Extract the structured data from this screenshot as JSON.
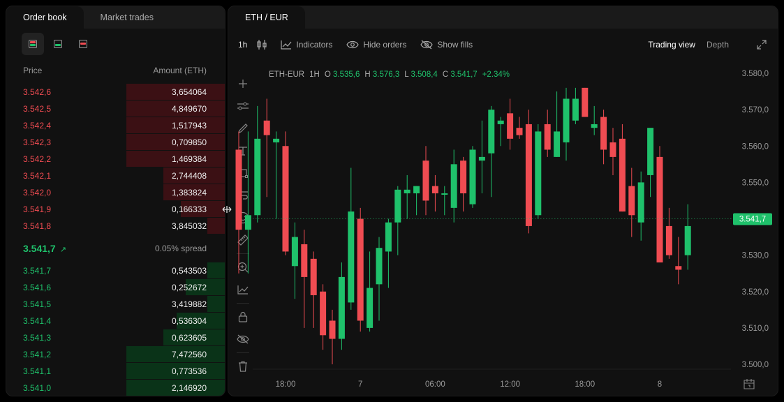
{
  "orderbook": {
    "tabs": [
      {
        "label": "Order book",
        "active": true
      },
      {
        "label": "Market trades",
        "active": false
      }
    ],
    "header": {
      "price": "Price",
      "amount": "Amount (ETH)"
    },
    "asks": [
      {
        "price": "3.542,6",
        "amount": "3,654064",
        "depth": 0.45
      },
      {
        "price": "3.542,5",
        "amount": "4,849670",
        "depth": 0.45
      },
      {
        "price": "3.542,4",
        "amount": "1,517943",
        "depth": 0.45
      },
      {
        "price": "3.542,3",
        "amount": "0,709850",
        "depth": 0.45
      },
      {
        "price": "3.542,2",
        "amount": "1,469384",
        "depth": 0.45
      },
      {
        "price": "3.542,1",
        "amount": "2,744408",
        "depth": 0.28
      },
      {
        "price": "3.542,0",
        "amount": "1,383824",
        "depth": 0.28
      },
      {
        "price": "3.541,9",
        "amount": "0,166333",
        "depth": 0.2
      },
      {
        "price": "3.541,8",
        "amount": "3,845032",
        "depth": 0.08
      }
    ],
    "spread": {
      "price": "3.541,7",
      "arrow": "↗",
      "text": "0.05% spread"
    },
    "bids": [
      {
        "price": "3.541,7",
        "amount": "0,543503",
        "depth": 0.08
      },
      {
        "price": "3.541,6",
        "amount": "0,252672",
        "depth": 0.18
      },
      {
        "price": "3.541,5",
        "amount": "3,419882",
        "depth": 0.08
      },
      {
        "price": "3.541,4",
        "amount": "0,536304",
        "depth": 0.22
      },
      {
        "price": "3.541,3",
        "amount": "0,623605",
        "depth": 0.28
      },
      {
        "price": "3.541,2",
        "amount": "7,472560",
        "depth": 0.45
      },
      {
        "price": "3.541,1",
        "amount": "0,773536",
        "depth": 0.45
      },
      {
        "price": "3.541,0",
        "amount": "2,146920",
        "depth": 0.45
      }
    ]
  },
  "chart_panel": {
    "tab": "ETH / EUR",
    "toolbar": {
      "timeframe": "1h",
      "indicators": "Indicators",
      "hide_orders": "Hide orders",
      "show_fills": "Show fills",
      "trading_view": "Trading view",
      "depth": "Depth"
    },
    "ohlc": {
      "symbol": "ETH-EUR",
      "interval": "1H",
      "o_label": "O",
      "o": "3.535,6",
      "h_label": "H",
      "h": "3.576,3",
      "l_label": "L",
      "l": "3.508,4",
      "c_label": "C",
      "c": "3.541,7",
      "change": "+2.34%"
    },
    "colors": {
      "up": "#1fc16b",
      "down": "#f04c52"
    }
  },
  "chart_data": {
    "type": "candlestick",
    "y_ticks": [
      "3.580,0",
      "3.570,0",
      "3.560,0",
      "3.550,0",
      "3.540,0",
      "3.530,0",
      "3.520,0",
      "3.510,0",
      "3.500,0"
    ],
    "y_tick_values": [
      3580,
      3570,
      3560,
      3550,
      3540,
      3530,
      3520,
      3510,
      3500
    ],
    "x_ticks": [
      {
        "label": "18:00",
        "index": 5
      },
      {
        "label": "7",
        "index": 13
      },
      {
        "label": "06:00",
        "index": 21
      },
      {
        "label": "12:00",
        "index": 29
      },
      {
        "label": "18:00",
        "index": 37
      },
      {
        "label": "8",
        "index": 45
      }
    ],
    "ylim": [
      3500,
      3580
    ],
    "current_price": {
      "label": "3.541,7",
      "value": 3540
    },
    "candles": [
      {
        "o": 3559,
        "h": 3564,
        "l": 3525,
        "c": 3537
      },
      {
        "o": 3537,
        "h": 3564,
        "l": 3525,
        "c": 3541
      },
      {
        "o": 3541,
        "h": 3571,
        "l": 3539,
        "c": 3562
      },
      {
        "o": 3567,
        "h": 3573,
        "l": 3546,
        "c": 3563
      },
      {
        "o": 3561,
        "h": 3564,
        "l": 3540,
        "c": 3562
      },
      {
        "o": 3560,
        "h": 3564,
        "l": 3530,
        "c": 3531
      },
      {
        "o": 3527,
        "h": 3539,
        "l": 3518,
        "c": 3535
      },
      {
        "o": 3533,
        "h": 3537,
        "l": 3510,
        "c": 3524
      },
      {
        "o": 3529,
        "h": 3531,
        "l": 3510,
        "c": 3519
      },
      {
        "o": 3520,
        "h": 3522,
        "l": 3504,
        "c": 3508
      },
      {
        "o": 3512,
        "h": 3515,
        "l": 3500,
        "c": 3507
      },
      {
        "o": 3507,
        "h": 3528,
        "l": 3504,
        "c": 3524
      },
      {
        "o": 3517,
        "h": 3554,
        "l": 3515,
        "c": 3542
      },
      {
        "o": 3540,
        "h": 3543,
        "l": 3509,
        "c": 3512
      },
      {
        "o": 3510,
        "h": 3531,
        "l": 3509,
        "c": 3521
      },
      {
        "o": 3522,
        "h": 3535,
        "l": 3512,
        "c": 3532
      },
      {
        "o": 3531,
        "h": 3540,
        "l": 3521,
        "c": 3539
      },
      {
        "o": 3539,
        "h": 3549,
        "l": 3530,
        "c": 3548
      },
      {
        "o": 3547,
        "h": 3552,
        "l": 3540,
        "c": 3548
      },
      {
        "o": 3547,
        "h": 3549,
        "l": 3541,
        "c": 3549
      },
      {
        "o": 3556,
        "h": 3560,
        "l": 3541,
        "c": 3545
      },
      {
        "o": 3549,
        "h": 3552,
        "l": 3542,
        "c": 3547
      },
      {
        "o": 3547,
        "h": 3549,
        "l": 3541,
        "c": 3547
      },
      {
        "o": 3543,
        "h": 3559,
        "l": 3539,
        "c": 3555
      },
      {
        "o": 3556,
        "h": 3557,
        "l": 3542,
        "c": 3547
      },
      {
        "o": 3544,
        "h": 3560,
        "l": 3543,
        "c": 3559
      },
      {
        "o": 3556,
        "h": 3567,
        "l": 3547,
        "c": 3557
      },
      {
        "o": 3558,
        "h": 3571,
        "l": 3546,
        "c": 3570
      },
      {
        "o": 3566,
        "h": 3568,
        "l": 3560,
        "c": 3567
      },
      {
        "o": 3569,
        "h": 3573,
        "l": 3559,
        "c": 3562
      },
      {
        "o": 3565,
        "h": 3568,
        "l": 3562,
        "c": 3563
      },
      {
        "o": 3566,
        "h": 3570,
        "l": 3536,
        "c": 3538
      },
      {
        "o": 3541,
        "h": 3566,
        "l": 3540,
        "c": 3564
      },
      {
        "o": 3566,
        "h": 3570,
        "l": 3557,
        "c": 3559
      },
      {
        "o": 3557,
        "h": 3575,
        "l": 3557,
        "c": 3564
      },
      {
        "o": 3561,
        "h": 3576,
        "l": 3556,
        "c": 3573
      },
      {
        "o": 3567,
        "h": 3576,
        "l": 3566,
        "c": 3573
      },
      {
        "o": 3576,
        "h": 3576,
        "l": 3568,
        "c": 3568
      },
      {
        "o": 3565,
        "h": 3571,
        "l": 3563,
        "c": 3566
      },
      {
        "o": 3568,
        "h": 3570,
        "l": 3555,
        "c": 3559
      },
      {
        "o": 3561,
        "h": 3565,
        "l": 3552,
        "c": 3557
      },
      {
        "o": 3562,
        "h": 3566,
        "l": 3542,
        "c": 3542
      },
      {
        "o": 3549,
        "h": 3554,
        "l": 3535,
        "c": 3541
      },
      {
        "o": 3539,
        "h": 3553,
        "l": 3534,
        "c": 3550
      },
      {
        "o": 3552,
        "h": 3561,
        "l": 3546,
        "c": 3565
      },
      {
        "o": 3557,
        "h": 3560,
        "l": 3530,
        "c": 3528
      },
      {
        "o": 3538,
        "h": 3543,
        "l": 3529,
        "c": 3530
      },
      {
        "o": 3527,
        "h": 3535,
        "l": 3522,
        "c": 3526
      },
      {
        "o": 3530,
        "h": 3544,
        "l": 3526,
        "c": 3538
      }
    ]
  }
}
